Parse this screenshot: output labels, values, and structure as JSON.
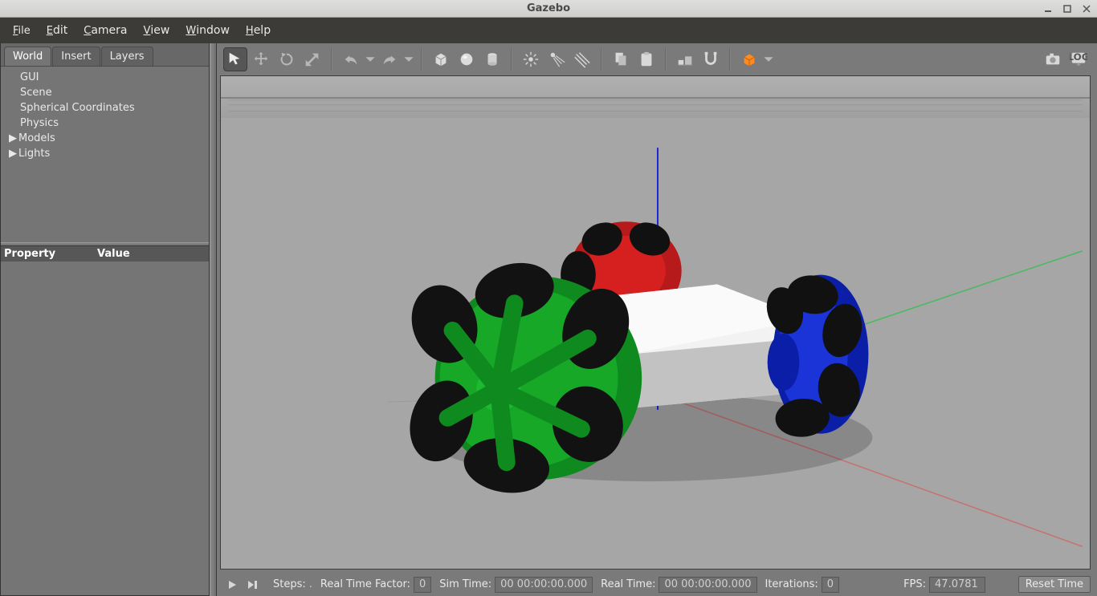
{
  "window": {
    "title": "Gazebo"
  },
  "menubar": {
    "file": "File",
    "edit": "Edit",
    "camera": "Camera",
    "view": "View",
    "window": "Window",
    "help": "Help"
  },
  "left": {
    "tabs": {
      "world": "World",
      "insert": "Insert",
      "layers": "Layers"
    },
    "tree": {
      "gui": "GUI",
      "scene": "Scene",
      "spherical": "Spherical Coordinates",
      "physics": "Physics",
      "models": "Models",
      "lights": "Lights"
    },
    "props": {
      "property": "Property",
      "value": "Value"
    }
  },
  "toolbar_icons": {
    "select": "select-icon",
    "translate": "translate-icon",
    "rotate": "rotate-icon",
    "scale": "scale-icon",
    "undo": "undo-icon",
    "undo_dd": "dropdown-icon",
    "redo": "redo-icon",
    "redo_dd": "dropdown-icon",
    "box": "box-icon",
    "sphere": "sphere-icon",
    "cylinder": "cylinder-icon",
    "pointlight": "point-light-icon",
    "spotlight": "spot-light-icon",
    "dirlight": "directional-light-icon",
    "copy": "copy-icon",
    "paste": "paste-icon",
    "align": "align-icon",
    "snap": "snap-icon",
    "viewangle": "view-angle-icon",
    "screenshot": "screenshot-icon",
    "log": "log-icon"
  },
  "bottombar": {
    "steps_label": "Steps:",
    "steps_value": ".",
    "rtf_label": "Real Time Factor:",
    "rtf_value": "0",
    "simtime_label": "Sim Time:",
    "simtime_value": "00 00:00:00.000",
    "realtime_label": "Real Time:",
    "realtime_value": "00 00:00:00.000",
    "iterations_label": "Iterations:",
    "iterations_value": "0",
    "fps_label": "FPS:",
    "fps_value": "47.0781",
    "reset": "Reset Time"
  }
}
